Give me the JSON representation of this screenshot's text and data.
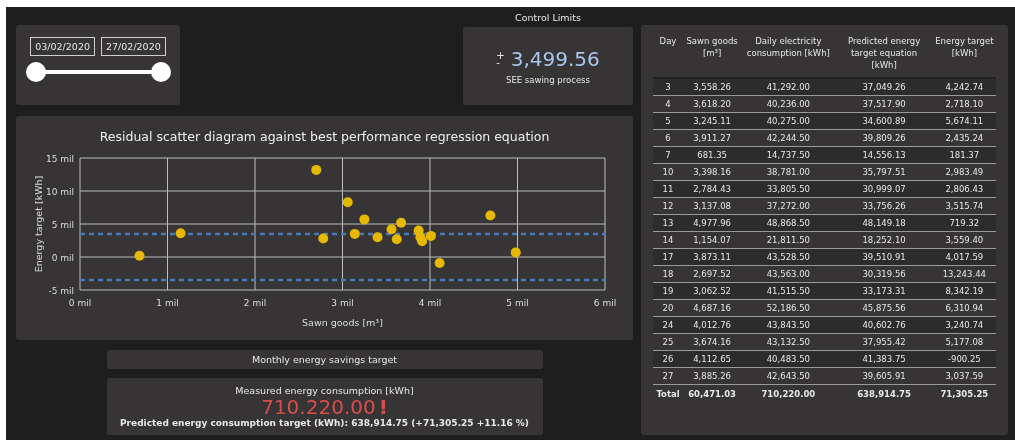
{
  "date_slicer": {
    "handles": [
      {
        "value": "03/02/2020",
        "level": 0
      },
      {
        "value": "27/02/2020",
        "level": 1
      }
    ]
  },
  "control_limits": {
    "title": "Control Limits",
    "sign_top": "+",
    "sign_bottom": "-",
    "value": "3,499.56",
    "caption": "SEE sawing process"
  },
  "scatter_chart": {
    "chart_data": {
      "type": "scatter",
      "title": "Residual scatter diagram against best performance regression equation",
      "xlabel": "Sawn goods [m³]",
      "ylabel": "Energy target [kWh]",
      "x": [
        3.56,
        3.62,
        3.25,
        3.91,
        0.68,
        3.4,
        2.78,
        3.14,
        4.98,
        1.15,
        3.87,
        2.7,
        3.06,
        4.69,
        4.01,
        3.67,
        4.11,
        3.89
      ],
      "series": [
        {
          "color": "#e6b800",
          "values": [
            4.2,
            2.7,
            5.7,
            2.4,
            0.2,
            3.0,
            2.8,
            3.5,
            0.7,
            3.6,
            4.0,
            13.2,
            8.3,
            6.3,
            3.2,
            5.2,
            -0.9,
            3.0
          ]
        }
      ],
      "grid": true,
      "xlim": [
        0,
        6
      ],
      "ylim": [
        -5,
        15
      ],
      "xticks": [
        {
          "value": 0,
          "label": "0 mil"
        },
        {
          "value": 1,
          "label": "1 mil"
        },
        {
          "value": 2,
          "label": "2 mil"
        },
        {
          "value": 3,
          "label": "3 mil"
        },
        {
          "value": 4,
          "label": "4 mil"
        },
        {
          "value": 5,
          "label": "5 mil"
        },
        {
          "value": 6,
          "label": "6 mil"
        }
      ],
      "yticks": [
        {
          "value": -5,
          "label": "-5 mil"
        },
        {
          "value": 0,
          "label": "0 mil"
        },
        {
          "value": 5,
          "label": "5 mil"
        },
        {
          "value": 10,
          "label": "10 mil"
        },
        {
          "value": 15,
          "label": "15 mil"
        }
      ],
      "ref_lines": [
        {
          "axis": "y",
          "value": 3.5
        },
        {
          "axis": "y",
          "value": -3.5
        }
      ]
    }
  },
  "savings": {
    "title": "Monthly energy savings target",
    "label": "Measured energy consumption [kWh]",
    "value": "710.220.00",
    "alert_mark": "!",
    "over_target": true,
    "predicted": "Predicted energy consumption target (kWh): 638,914.75 (+71,305.25 +11.16 %)"
  },
  "table": {
    "columns": [
      "Day",
      "Sawn goods [m³]",
      "Daily electricity consumption [kWh]",
      "Predicted energy target equation [kWh]",
      "Energy target [kWh]"
    ],
    "rows": [
      [
        "3",
        "3,558.26",
        "41,292.00",
        "37,049.26",
        "4,242.74"
      ],
      [
        "4",
        "3,618.20",
        "40,236.00",
        "37,517.90",
        "2,718.10"
      ],
      [
        "5",
        "3,245.11",
        "40,275.00",
        "34,600.89",
        "5,674.11"
      ],
      [
        "6",
        "3,911.27",
        "42,244.50",
        "39,809.26",
        "2,435.24"
      ],
      [
        "7",
        "681.35",
        "14,737.50",
        "14,556.13",
        "181.37"
      ],
      [
        "10",
        "3,398.16",
        "38,781.00",
        "35,797.51",
        "2,983.49"
      ],
      [
        "11",
        "2,784.43",
        "33,805.50",
        "30,999.07",
        "2,806.43"
      ],
      [
        "12",
        "3,137.08",
        "37,272.00",
        "33,756.26",
        "3,515.74"
      ],
      [
        "13",
        "4,977.96",
        "48,868.50",
        "48,149.18",
        "719.32"
      ],
      [
        "14",
        "1,154.07",
        "21,811.50",
        "18,252.10",
        "3,559.40"
      ],
      [
        "17",
        "3,873.11",
        "43,528.50",
        "39,510.91",
        "4,017.59"
      ],
      [
        "18",
        "2,697.52",
        "43,563.00",
        "30,319.56",
        "13,243.44"
      ],
      [
        "19",
        "3,062.52",
        "41,515.50",
        "33,173.31",
        "8,342.19"
      ],
      [
        "20",
        "4,687.16",
        "52,186.50",
        "45,875.56",
        "6,310.94"
      ],
      [
        "24",
        "4,012.76",
        "43,843.50",
        "40,602.76",
        "3,240.74"
      ],
      [
        "25",
        "3,674.16",
        "43,132.50",
        "37,955.42",
        "5,177.08"
      ],
      [
        "26",
        "4,112.65",
        "40,483.50",
        "41,383.75",
        "-900.25"
      ],
      [
        "27",
        "3,885.26",
        "42,643.50",
        "39,605.91",
        "3,037.59"
      ]
    ],
    "total": [
      "Total",
      "60,471.03",
      "710,220.00",
      "638,914.75",
      "71,305.25"
    ]
  }
}
